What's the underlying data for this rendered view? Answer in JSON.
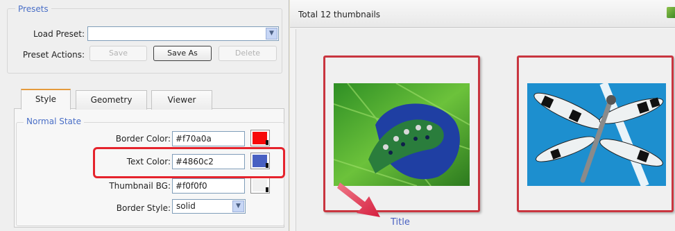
{
  "presets": {
    "legend": "Presets",
    "load_label": "Load Preset:",
    "load_value": "",
    "actions_label": "Preset Actions:",
    "save_label": "Save",
    "save_as_label": "Save As",
    "delete_label": "Delete"
  },
  "tabs": [
    {
      "label": "Style",
      "active": true
    },
    {
      "label": "Geometry",
      "active": false
    },
    {
      "label": "Viewer",
      "active": false
    }
  ],
  "normal_state": {
    "legend": "Normal State",
    "border_color_label": "Border Color:",
    "border_color_value": "#f70a0a",
    "text_color_label": "Text Color:",
    "text_color_value": "#4860c2",
    "thumb_bg_label": "Thumbnail BG:",
    "thumb_bg_value": "#f0f0f0",
    "border_style_label": "Border Style:",
    "border_style_value": "solid"
  },
  "gallery": {
    "total_label": "Total 12 thumbnails",
    "thumb_title": "Title"
  },
  "colors": {
    "legend_blue": "#4a6fc7",
    "highlight_red": "#e5232c",
    "arrow_pink": "#e23a52"
  }
}
